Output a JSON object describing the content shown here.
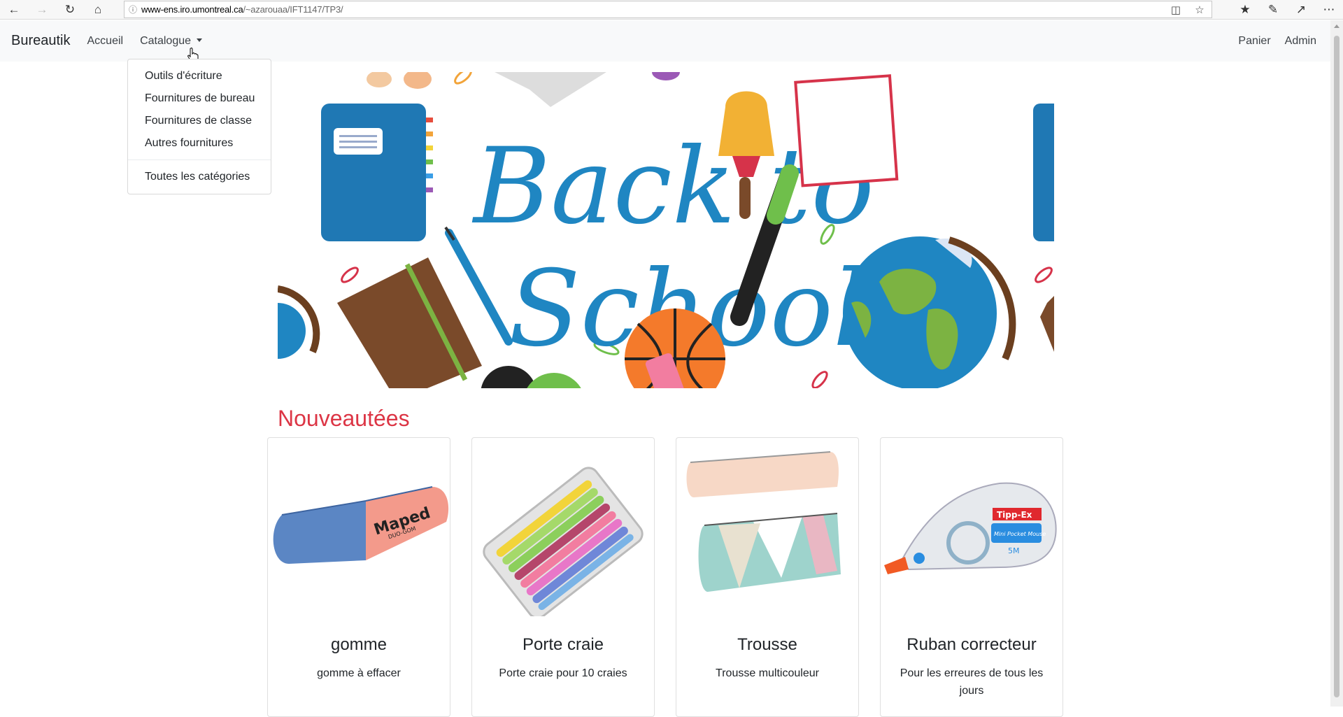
{
  "browser": {
    "url_host": "www-ens.iro.umontreal.ca",
    "url_path": "/~azarouaa/IFT1147/TP3/"
  },
  "navbar": {
    "brand": "Bureautik",
    "links": [
      "Accueil",
      "Catalogue"
    ],
    "right_links": [
      "Panier",
      "Admin"
    ]
  },
  "dropdown": {
    "items": [
      "Outils d'écriture",
      "Fournitures de bureau",
      "Fournitures de classe",
      "Autres fournitures"
    ],
    "all_label": "Toutes les catégories"
  },
  "hero": {
    "text_line1": "Back to",
    "text_line2": "School"
  },
  "section": {
    "title": "Nouveautées"
  },
  "products": [
    {
      "name": "gomme",
      "description": "gomme à effacer",
      "brand_text": "Maped",
      "brand_sub": "DUO-GOM"
    },
    {
      "name": "Porte craie",
      "description": "Porte craie pour 10 craies"
    },
    {
      "name": "Trousse",
      "description": "Trousse multicouleur"
    },
    {
      "name": "Ruban correcteur",
      "description": "Pour les erreures de tous les jours",
      "brand_text": "Tipp-Ex",
      "brand_sub": "Mini Pocket Mouse",
      "brand_size": "5M"
    }
  ],
  "colors": {
    "accent": "#dc3545",
    "navbar_bg": "#f8f9fa",
    "hero_text": "#1f86c2"
  }
}
